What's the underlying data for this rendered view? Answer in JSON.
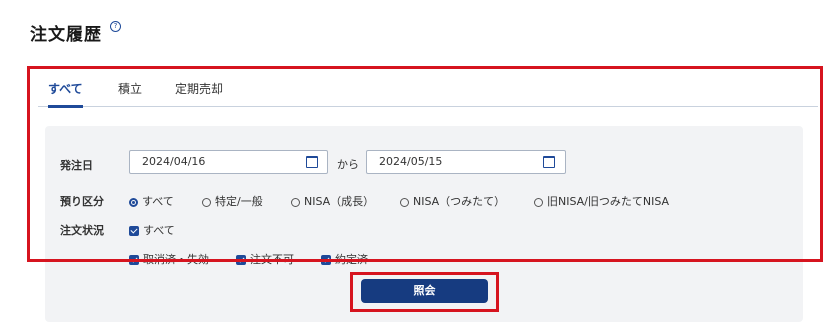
{
  "page": {
    "title": "注文履歴",
    "help_icon": "question-circle-icon"
  },
  "tabs": [
    {
      "label": "すべて",
      "active": true
    },
    {
      "label": "積立",
      "active": false
    },
    {
      "label": "定期売却",
      "active": false
    }
  ],
  "filters": {
    "order_date": {
      "label": "発注日",
      "from": "2024/04/16",
      "separator": "から",
      "to": "2024/05/15",
      "icon": "calendar-icon"
    },
    "account_type": {
      "label": "預り区分",
      "options": [
        {
          "label": "すべて",
          "selected": true
        },
        {
          "label": "特定/一般",
          "selected": false
        },
        {
          "label": "NISA（成長）",
          "selected": false
        },
        {
          "label": "NISA（つみたて）",
          "selected": false
        },
        {
          "label": "旧NISA/旧つみたてNISA",
          "selected": false
        }
      ]
    },
    "order_status": {
      "label": "注文状況",
      "all": {
        "label": "すべて",
        "checked": true
      },
      "options": [
        {
          "label": "取消済・失効",
          "checked": true
        },
        {
          "label": "注文不可",
          "checked": true
        },
        {
          "label": "約定済",
          "checked": true
        }
      ]
    }
  },
  "actions": {
    "submit_label": "照会"
  },
  "colors": {
    "accent": "#1f4a99",
    "button": "#163b80",
    "highlight": "#d6141f",
    "panel": "#f2f3f5"
  }
}
